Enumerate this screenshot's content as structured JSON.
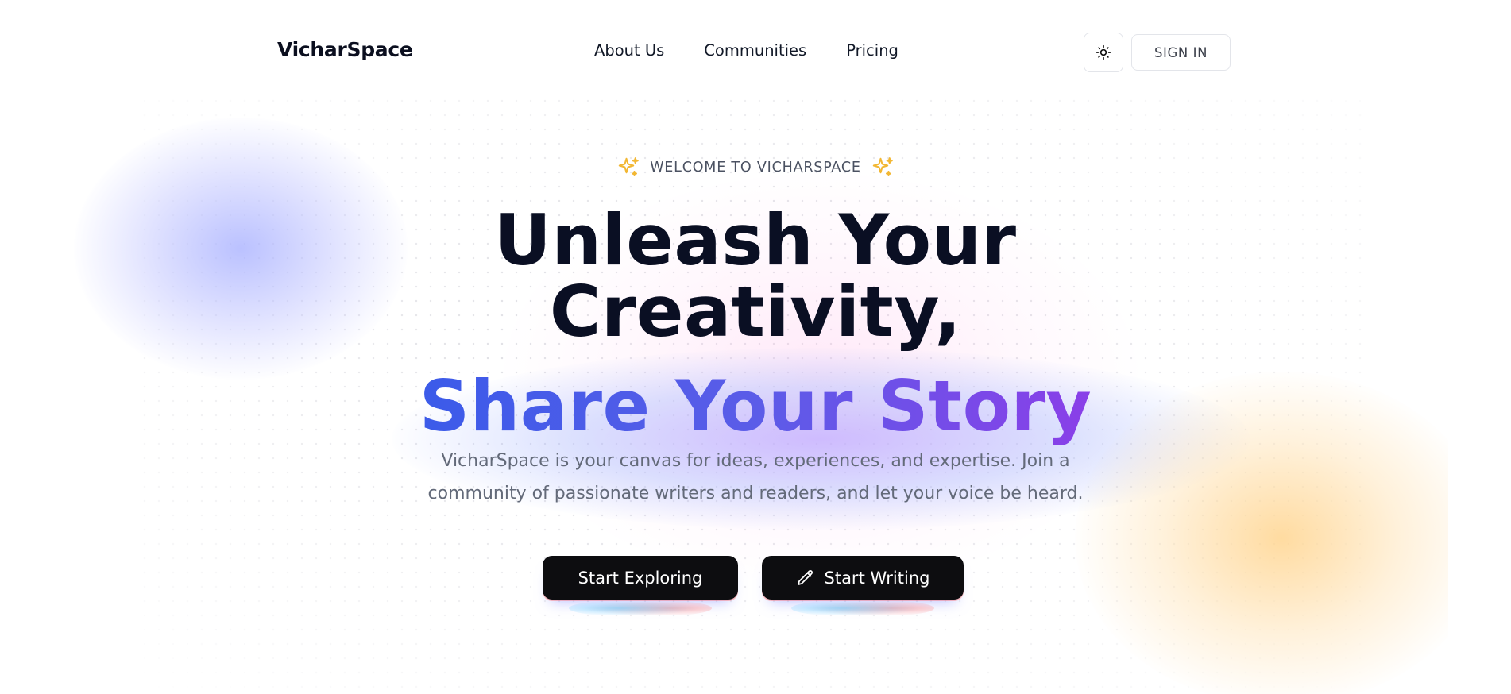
{
  "brand": {
    "name": "VicharSpace"
  },
  "nav": {
    "links": [
      {
        "label": "About Us"
      },
      {
        "label": "Communities"
      },
      {
        "label": "Pricing"
      }
    ],
    "theme_toggle_icon": "sun-icon",
    "sign_in_label": "SIGN IN"
  },
  "hero": {
    "badge": "WELCOME TO VICHARSPACE",
    "badge_icon": "sparkle-icon",
    "headline_line1": "Unleash Your",
    "headline_line2": "Creativity,",
    "headline_gradient": "Share Your Story",
    "subtitle_line1": "VicharSpace is your canvas for ideas, experiences, and expertise. Join a",
    "subtitle_line2": "community of passionate writers and readers, and let your voice be heard.",
    "cta_primary": "Start Exploring",
    "cta_secondary": "Start Writing",
    "cta_secondary_icon": "pencil-icon"
  },
  "colors": {
    "headline": "#0a0f23",
    "gradient_start": "#3b5be9",
    "gradient_end": "#8a3fe8",
    "button_bg": "#0d0d10",
    "sparkle": "#f2b733"
  }
}
